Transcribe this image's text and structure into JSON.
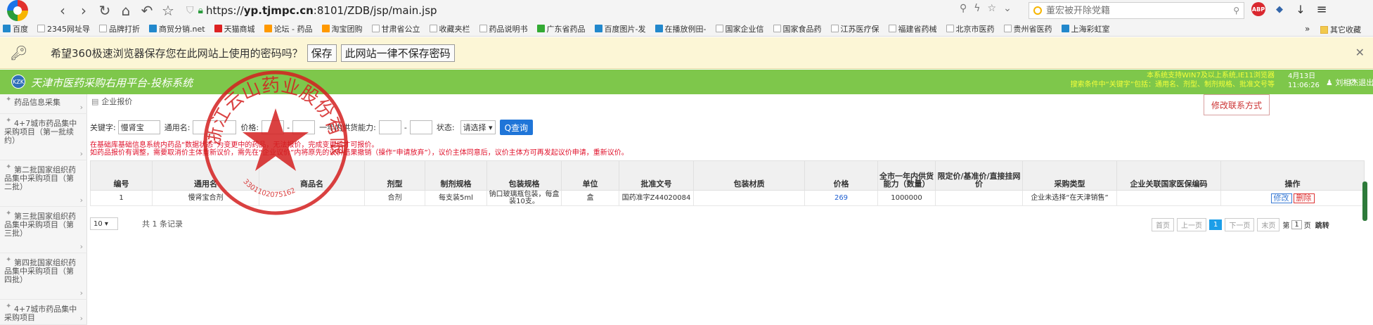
{
  "browser": {
    "url_prefix": "https://",
    "url_host": "yp.tjmpc.cn",
    "url_rest": ":8101/ZDB/jsp/main.jsp",
    "search_placeholder": "董宏被开除党籍",
    "bookmarks": [
      "百度",
      "2345网址导",
      "品牌打折",
      "商贸分销.net",
      "天猫商城",
      "论坛 - 药品",
      "淘宝团购",
      "甘肃省公立",
      "收藏夹栏",
      "药品说明书",
      "广东省药品",
      "百度图片-发",
      "在播放例田-",
      "国家企业信",
      "国家食品药",
      "江苏医疗保",
      "福建省药械",
      "北京市医药",
      "贵州省医药",
      "上海彩虹室"
    ],
    "bookmarks_more": "»",
    "bookmarks_other": "其它收藏",
    "password_prompt": "希望360极速浏览器保存您在此网站上使用的密码吗？",
    "save_label": "保存",
    "never_label": "此网站一律不保存密码",
    "close_glyph": "✕"
  },
  "app": {
    "logo_text": "KZK",
    "system_name": "天津市医药采购右用平台-投标系统",
    "notice_line1": "本系统支持WIN7及以上系统,IE11浏览器",
    "notice_line2": "搜索条件中“关键字”包括：通用名、剂型、制剂规格、批准文号等",
    "date": "4月13日",
    "time": "11:06:26",
    "user": "刘相杰",
    "logout": "退出"
  },
  "sidebar": {
    "items": [
      {
        "label": "药品信息采集"
      },
      {
        "label": "4+7城市药品集中采购项目（第一批续约）"
      },
      {
        "label": "第二批国家组织药品集中采购项目（第二批）"
      },
      {
        "label": "第三批国家组织药品集中采购项目（第三批）"
      },
      {
        "label": "第四批国家组织药品集中采购项目（第四批）"
      },
      {
        "label": "4+7城市药品集中采购项目"
      }
    ]
  },
  "main": {
    "tab_label": "企业报价",
    "contact_btn": "修改联系方式",
    "filters": {
      "keyword_label": "关键字:",
      "keyword_value": "慢肾宝",
      "generic_label": "通用名:",
      "price_label": "价格:",
      "dash": "-",
      "capacity_label": "一年内供货能力:",
      "status_label": "状态:",
      "status_value": "请选择",
      "query_label": "Q查询"
    },
    "warn_line1": "在基础库基础信息系统内药品“数据状态”为变更中的药品，无法报价，完成变更后才可报价。",
    "warn_line2": "如药品报价有调整，需要取消价主体重新议价，需先在“企业议价”内将原先的议价结果撤销（操作“申请放弃”），议价主体同意后，议价主体方可再发起议价申请，重新议价。",
    "columns": [
      "编号",
      "通用名",
      "商品名",
      "剂型",
      "制剂规格",
      "包装规格",
      "单位",
      "批准文号",
      "包装材质",
      "价格",
      "全市一年内供货能力（数量）",
      "限定价/基准价/直接挂网价",
      "采购类型",
      "企业关联国家医保编码",
      "操作"
    ],
    "rows": [
      {
        "no": "1",
        "generic": "慢肾宝合剂",
        "trade": "",
        "form": "合剂",
        "spec": "每支装5ml",
        "pack": "钠口玻璃瓶包装，每盒装10支。",
        "unit": "盒",
        "approval": "国药准字Z44020084",
        "material": "",
        "price": "269",
        "capacity": "1000000",
        "limit": "",
        "ptype": "企业未选择“在天津销售”",
        "code": "",
        "edit": "修改",
        "delete": "删除"
      }
    ],
    "page_size": "10",
    "total": "共 1 条记录",
    "pager": {
      "first": "首页",
      "prev": "上一页",
      "current": "1",
      "next": "下一页",
      "last": "末页",
      "page_prefix": "第",
      "page_value": "1",
      "page_suffix": "页",
      "go": "跳转"
    }
  },
  "seal": {
    "outer_text": "浙江云山药业股份有限公司",
    "number": "3301102075162"
  }
}
